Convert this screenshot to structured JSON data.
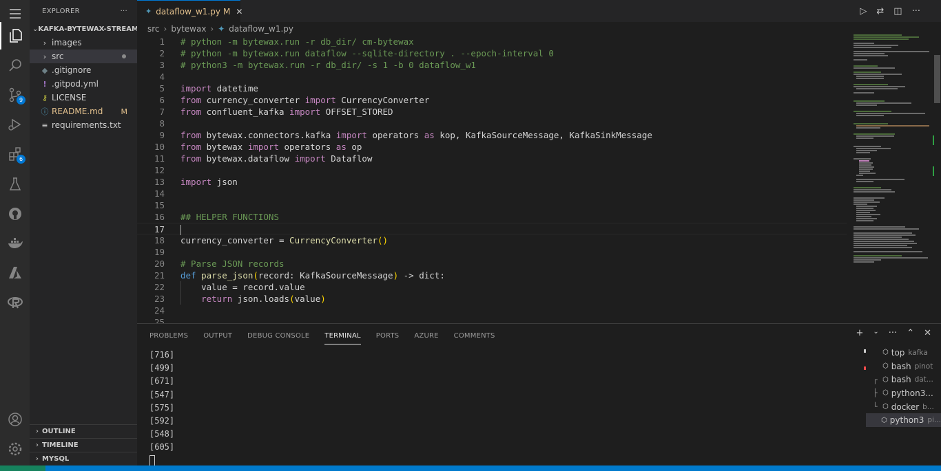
{
  "activity_bar": {
    "scm_badge": "9",
    "extensions_badge": "6"
  },
  "sidebar": {
    "title": "EXPLORER",
    "more": "···",
    "root": "KAFKA-BYTEWAX-STREAM...",
    "items": [
      {
        "label": "images",
        "icon": "chevron-right",
        "mod": ""
      },
      {
        "label": "src",
        "icon": "chevron-right",
        "mod": ""
      },
      {
        "label": ".gitignore",
        "icon": "gitignore-icon",
        "mod": ""
      },
      {
        "label": ".gitpod.yml",
        "icon": "yaml-icon",
        "mod": ""
      },
      {
        "label": "LICENSE",
        "icon": "license-icon",
        "mod": ""
      },
      {
        "label": "README.md",
        "icon": "info-icon",
        "mod": "M"
      },
      {
        "label": "requirements.txt",
        "icon": "text-file-icon",
        "mod": ""
      }
    ],
    "sections": [
      "OUTLINE",
      "TIMELINE",
      "MYSQL"
    ]
  },
  "tab": {
    "filename": "dataflow_w1.py",
    "modified": "M",
    "close": "✕"
  },
  "breadcrumb": [
    "src",
    "bytewax",
    "dataflow_w1.py"
  ],
  "editor": {
    "line_numbers": [
      "1",
      "2",
      "3",
      "4",
      "5",
      "6",
      "7",
      "8",
      "9",
      "10",
      "11",
      "12",
      "13",
      "14",
      "15",
      "16",
      "17",
      "18",
      "19",
      "20",
      "21",
      "22",
      "23",
      "24",
      "25"
    ],
    "current_line": "17"
  },
  "panel": {
    "tabs": [
      "PROBLEMS",
      "OUTPUT",
      "DEBUG CONSOLE",
      "TERMINAL",
      "PORTS",
      "AZURE",
      "COMMENTS"
    ],
    "active_tab": "TERMINAL",
    "output": [
      "[716]",
      "[499]",
      "[671]",
      "[547]",
      "[575]",
      "[592]",
      "[548]",
      "[605]"
    ],
    "terminals": [
      {
        "tree": "",
        "name": "top",
        "sub": "kafka"
      },
      {
        "tree": "",
        "name": "bash",
        "sub": "pinot"
      },
      {
        "tree": "┌",
        "name": "bash",
        "sub": "dat..."
      },
      {
        "tree": "├",
        "name": "python3...",
        "sub": ""
      },
      {
        "tree": "└",
        "name": "docker",
        "sub": "b..."
      },
      {
        "tree": "",
        "name": "python3",
        "sub": "pi..."
      }
    ]
  },
  "colors": {
    "accent": "#0078d4",
    "status_bar": "#007acc",
    "remote": "#16825d",
    "modified": "#e2c08d"
  }
}
